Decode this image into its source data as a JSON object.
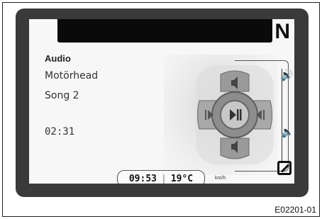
{
  "display": {
    "gear_indicator": "N",
    "source_label": "Audio",
    "artist": "Motörhead",
    "song": "Song 2",
    "elapsed_time": "02:31",
    "clock": "09:53",
    "temperature": "19°C",
    "speed_unit": "km/h"
  },
  "controls": {
    "volume_up_icon": "speaker-volume-up-icon",
    "volume_down_icon": "speaker-volume-down-icon",
    "play_pause_icon": "play-pause-icon",
    "previous_icon": "skip-previous-icon",
    "next_icon": "skip-next-icon"
  },
  "figure_code": "E02201-01"
}
